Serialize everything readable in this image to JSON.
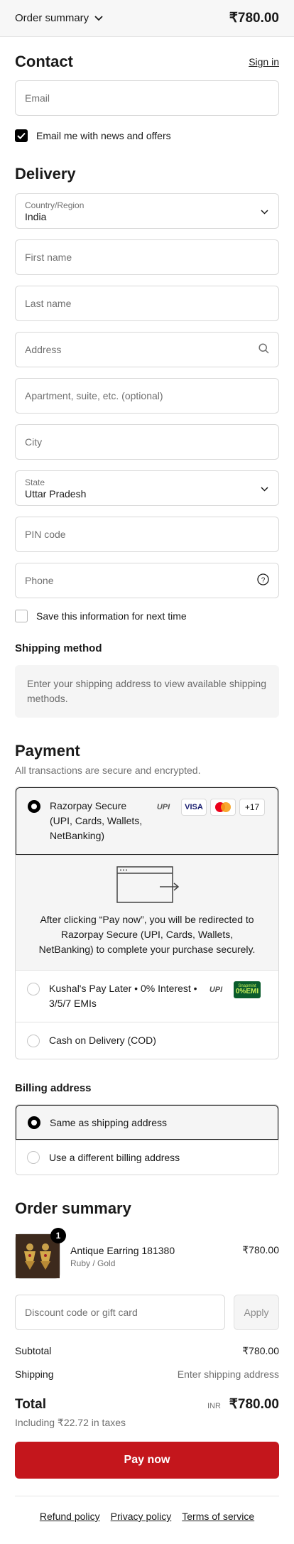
{
  "header": {
    "order_summary_label": "Order summary",
    "total": "₹780.00"
  },
  "contact": {
    "title": "Contact",
    "sign_in": "Sign in",
    "email_placeholder": "Email",
    "news_label": "Email me with news and offers"
  },
  "delivery": {
    "title": "Delivery",
    "country_label": "Country/Region",
    "country_value": "India",
    "first_name": "First name",
    "last_name": "Last name",
    "address": "Address",
    "apartment": "Apartment, suite, etc. (optional)",
    "city": "City",
    "state_label": "State",
    "state_value": "Uttar Pradesh",
    "pin": "PIN code",
    "phone": "Phone",
    "save_info": "Save this information for next time"
  },
  "shipping": {
    "title": "Shipping method",
    "empty": "Enter your shipping address to view available shipping methods."
  },
  "payment": {
    "title": "Payment",
    "subtitle": "All transactions are secure and encrypted.",
    "options": [
      {
        "label": "Razorpay Secure (UPI, Cards, Wallets, NetBanking)"
      },
      {
        "label": "Kushal's Pay Later • 0% Interest • 3/5/7 EMIs"
      },
      {
        "label": "Cash on Delivery (COD)"
      }
    ],
    "badges": {
      "upi": "UPI",
      "visa": "VISA",
      "more": "+17",
      "snap_top": "Snapmint",
      "snap_bottom": "0%EMI"
    },
    "redirect_text": "After clicking “Pay now”, you will be redirected to Razorpay Secure (UPI, Cards, Wallets, NetBanking) to complete your purchase securely."
  },
  "billing": {
    "title": "Billing address",
    "options": [
      {
        "label": "Same as shipping address"
      },
      {
        "label": "Use a different billing address"
      }
    ]
  },
  "summary": {
    "title": "Order summary",
    "product": {
      "name": "Antique Earring 181380",
      "variant": "Ruby / Gold",
      "price": "₹780.00",
      "qty": "1"
    },
    "discount_placeholder": "Discount code or gift card",
    "apply": "Apply",
    "subtotal_label": "Subtotal",
    "subtotal_value": "₹780.00",
    "shipping_label": "Shipping",
    "shipping_value": "Enter shipping address",
    "total_label": "Total",
    "currency": "INR",
    "total_value": "₹780.00",
    "tax_note": "Including ₹22.72 in taxes",
    "pay_now": "Pay now"
  },
  "footer": {
    "links": [
      "Refund policy",
      "Privacy policy",
      "Terms of service"
    ]
  },
  "colors": {
    "accent": "#c4161c",
    "text": "#1a1a1a",
    "muted": "#707070"
  }
}
